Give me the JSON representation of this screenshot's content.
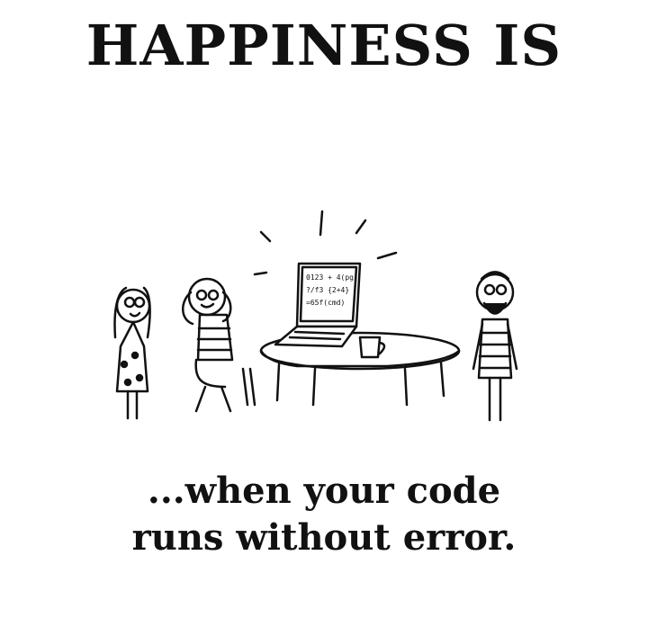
{
  "headline": "HAPPINESS IS",
  "caption": {
    "line1": "...when your code",
    "line2": "runs without error."
  },
  "illustration": {
    "screen_code_lines": [
      "0123 + 4(pg",
      "?/f3 {2+4}",
      "=65f(cmd)"
    ]
  },
  "colors": {
    "ink": "#111111",
    "background": "#ffffff"
  }
}
